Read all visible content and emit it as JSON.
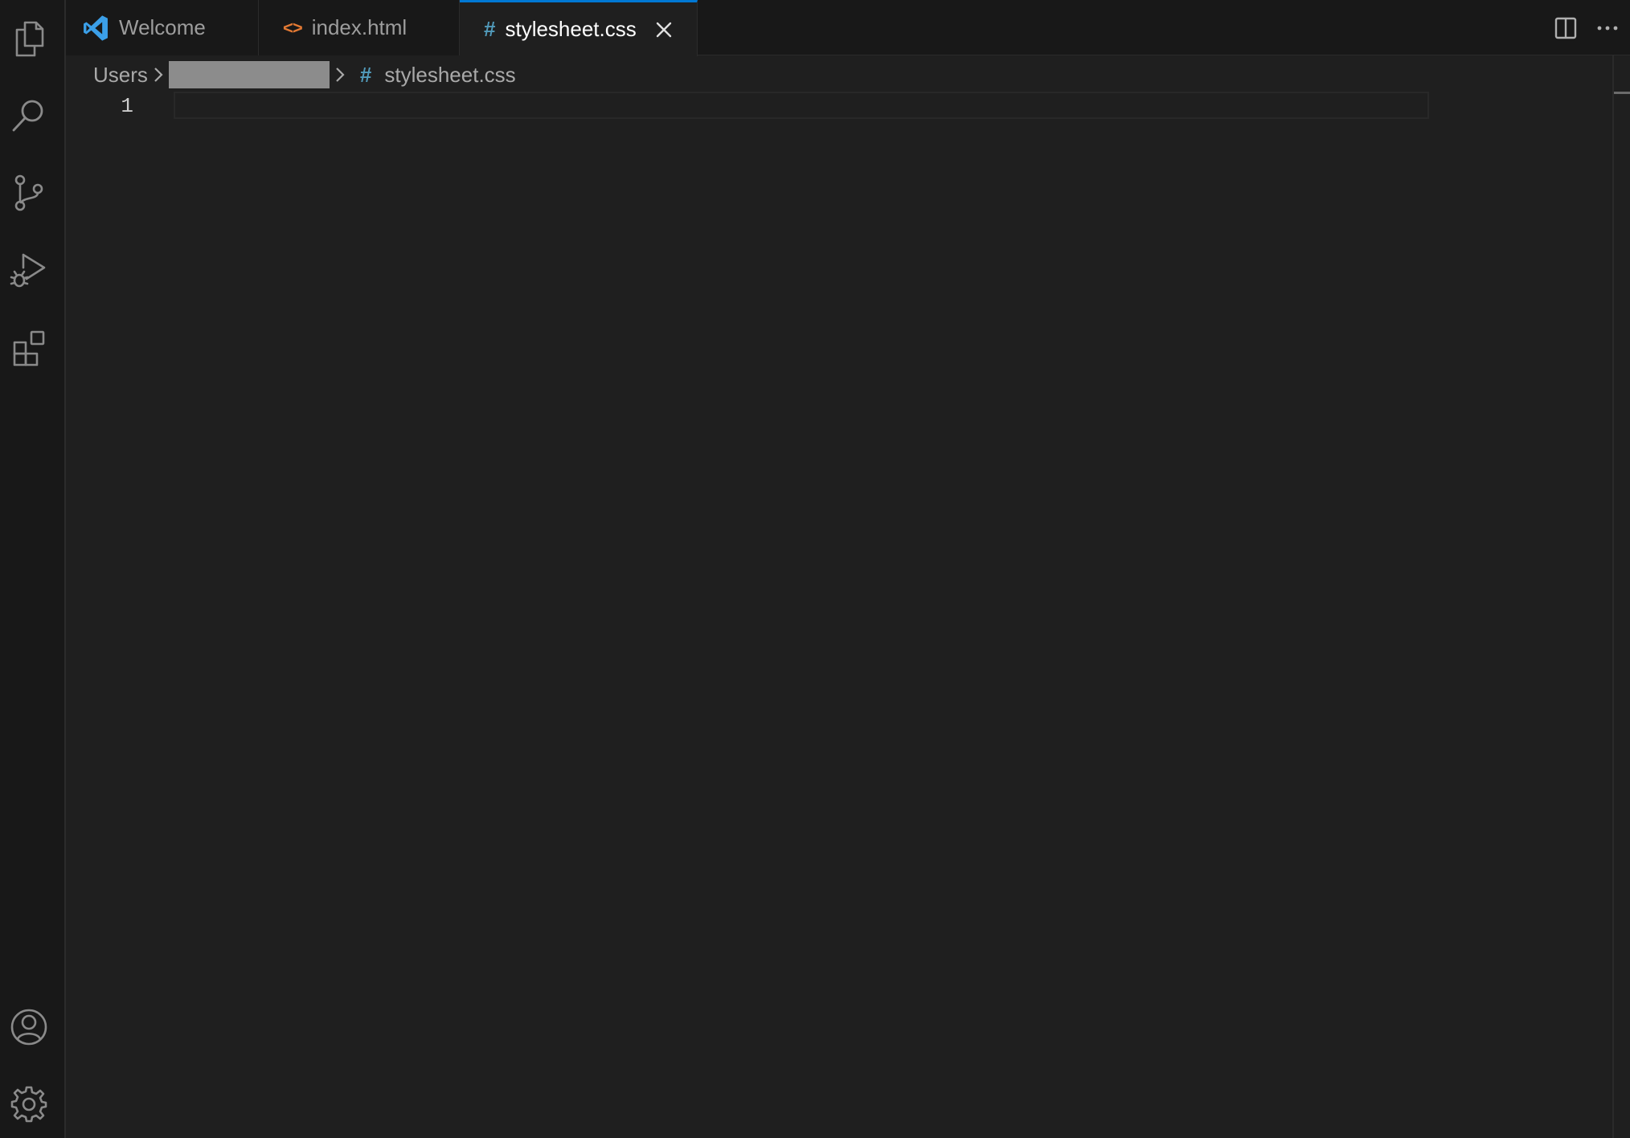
{
  "tabs": [
    {
      "label": "Welcome",
      "icon": "vscode-logo-icon",
      "active": false
    },
    {
      "label": "index.html",
      "icon": "html-code-icon",
      "active": false
    },
    {
      "label": "stylesheet.css",
      "icon": "css-hash-icon",
      "active": true
    }
  ],
  "tab_icons": {
    "html_glyph": "<>",
    "css_glyph": "#"
  },
  "breadcrumb": {
    "root": "Users",
    "file": "stylesheet.css"
  },
  "editor": {
    "line_numbers": [
      "1"
    ],
    "content": ""
  },
  "activity_bar": {
    "items": [
      "explorer-icon",
      "search-icon",
      "source-control-icon",
      "run-debug-icon",
      "extensions-icon"
    ],
    "bottom": [
      "account-icon",
      "settings-gear-icon"
    ]
  },
  "colors": {
    "accent": "#0078d4",
    "css_icon": "#519aba",
    "html_icon": "#e37933",
    "vscode_logo": "#3b9fe8",
    "editor_bg": "#1f1f1f",
    "sidebar_bg": "#181818"
  }
}
